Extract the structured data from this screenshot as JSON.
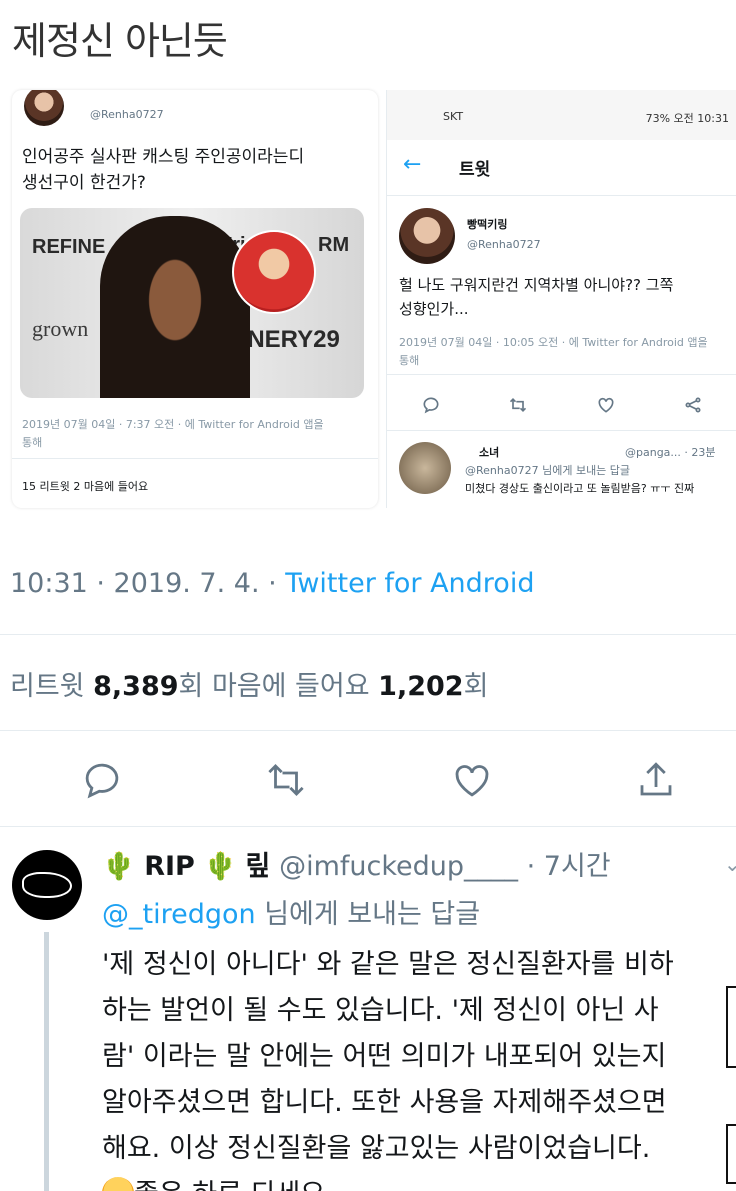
{
  "post_title": "제정신 아닌듯",
  "left_tweet": {
    "handle": "@Renha0727",
    "text_line1": "인어공주 실사판 캐스팅 주인공이라는디",
    "text_line2": "생선구이 한건가?",
    "photo_text": [
      "REFINE",
      "Fri",
      "RM",
      "grown",
      "FINERY29"
    ],
    "meta_line1": "2019년 07월 04일 · 7:37 오전 · 에 Twitter for Android 앱을",
    "meta_line2": "통해",
    "stats": "15 리트윗   2 마음에 들어요"
  },
  "right_tweet": {
    "status_carrier": "SKT",
    "status_right": "73% 오전 10:31",
    "app_title": "트윗",
    "name": "빵떡키링",
    "handle": "@Renha0727",
    "text_line1": "헐 나도 구워지란건 지역차별 아니야?? 그쪽",
    "text_line2": "성향인가...",
    "meta_line1": "2019년 07월 04일 · 10:05 오전 · 에 Twitter for Android 앱을",
    "meta_line2": "통해",
    "reply_name": "소녀",
    "reply_handle": "@panga... · 23분",
    "reply_to": "@Renha0727 님에게 보내는 답글",
    "reply_text": "미쳤다 경상도 출신이라고 또 놀림받음? ㅠㅜ 진짜"
  },
  "main": {
    "time": "10:31 · 2019. 7. 4. · ",
    "source": "Twitter for Android",
    "retweet_label": "리트윗 ",
    "retweet_count": "8,389",
    "retweet_unit": "회   마음에 들어요 ",
    "like_count": "1,202",
    "like_unit": "회"
  },
  "reply": {
    "name_prefix": "RIP",
    "name_suffix": "맆",
    "handle": "@imfuckedup____ · 7시간",
    "reply_to_mention": "@_tiredgon",
    "reply_to_rest": " 님에게 보내는 답글",
    "lines": [
      "'제 정신이 아니다' 와 같은 말은 정신질환자를 비하",
      "하는 발언이 될 수도 있습니다. '제 정신이 아닌 사",
      "람' 이라는 말 안에는 어떤 의미가 내포되어 있는지",
      "알아주셨으면 합니다. 또한 사용을 자제해주셨으면",
      "해요. 이상 정신질환을 앓고있는 사람이었습니다."
    ],
    "last_line": "좋은 하루 되세요."
  }
}
